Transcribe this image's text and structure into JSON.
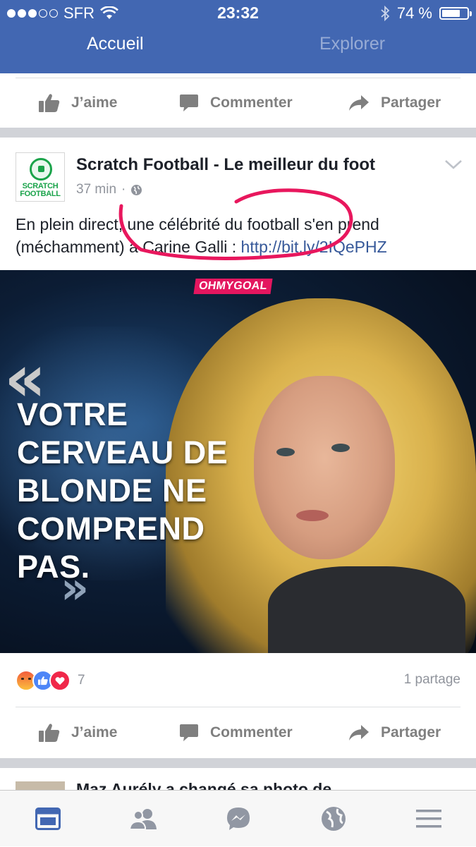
{
  "status_bar": {
    "carrier": "SFR",
    "time": "23:32",
    "battery": "74 %",
    "battery_level": 0.74,
    "signal_bars": 3,
    "signal_total": 5
  },
  "nav": {
    "tabs": [
      {
        "label": "Accueil",
        "active": true
      },
      {
        "label": "Explorer",
        "active": false
      }
    ]
  },
  "actions": {
    "like": "J’aime",
    "comment": "Commenter",
    "share": "Partager"
  },
  "post": {
    "avatar_text_line1": "SCRATCH",
    "avatar_text_line2": "FOOTBALL",
    "page_name": "Scratch Football - Le meilleur du foot",
    "time": "37 min",
    "meta_separator": "·",
    "text": "En plein direct, une célébrité du football s'en prend (méchamment) à Carine Galli : ",
    "link": "http://bit.ly/2IQePHZ",
    "image": {
      "badge": "OHMYGOAL",
      "quote_open": "«",
      "quote_close": "»",
      "headline": "VOTRE CERVEAU DE BLONDE NE COMPREND PAS."
    },
    "reactions": {
      "count": "7",
      "types": [
        "angry",
        "like",
        "love"
      ]
    },
    "shares": "1 partage"
  },
  "next_post": {
    "text": "Maz Aurély a changé sa photo de"
  },
  "tabbar": {
    "items": [
      "news-feed",
      "friends",
      "messenger",
      "notifications-globe",
      "menu"
    ],
    "active": "news-feed"
  },
  "colors": {
    "brand_blue": "#4267b2",
    "link_blue": "#365899",
    "annotation_pink": "#e8175d",
    "muted_text": "#90949c"
  }
}
